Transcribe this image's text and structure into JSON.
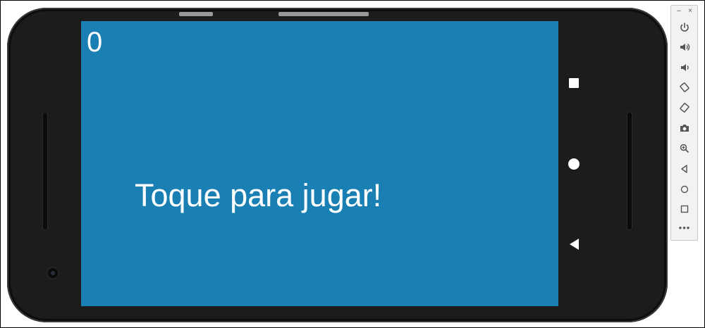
{
  "app": {
    "score": "0",
    "prompt": "Toque para jugar!"
  },
  "colors": {
    "screen_background": "#1a7fb3",
    "text": "#ffffff",
    "phone_body": "#1c1c1c"
  },
  "navigation_bar": {
    "buttons": [
      {
        "name": "overview",
        "icon": "square-icon"
      },
      {
        "name": "home",
        "icon": "circle-icon"
      },
      {
        "name": "back",
        "icon": "triangle-back-icon"
      }
    ]
  },
  "emulator_toolbar": {
    "minimize_label": "–",
    "close_label": "×",
    "more_label": "•••",
    "buttons": [
      {
        "name": "power",
        "icon": "power-icon"
      },
      {
        "name": "volume-up",
        "icon": "volume-up-icon"
      },
      {
        "name": "volume-down",
        "icon": "volume-down-icon"
      },
      {
        "name": "rotate-left",
        "icon": "rotate-left-icon"
      },
      {
        "name": "rotate-right",
        "icon": "rotate-right-icon"
      },
      {
        "name": "screenshot",
        "icon": "camera-icon"
      },
      {
        "name": "zoom",
        "icon": "zoom-icon"
      },
      {
        "name": "back",
        "icon": "back-icon"
      },
      {
        "name": "home",
        "icon": "home-icon"
      },
      {
        "name": "overview",
        "icon": "overview-icon"
      }
    ]
  }
}
